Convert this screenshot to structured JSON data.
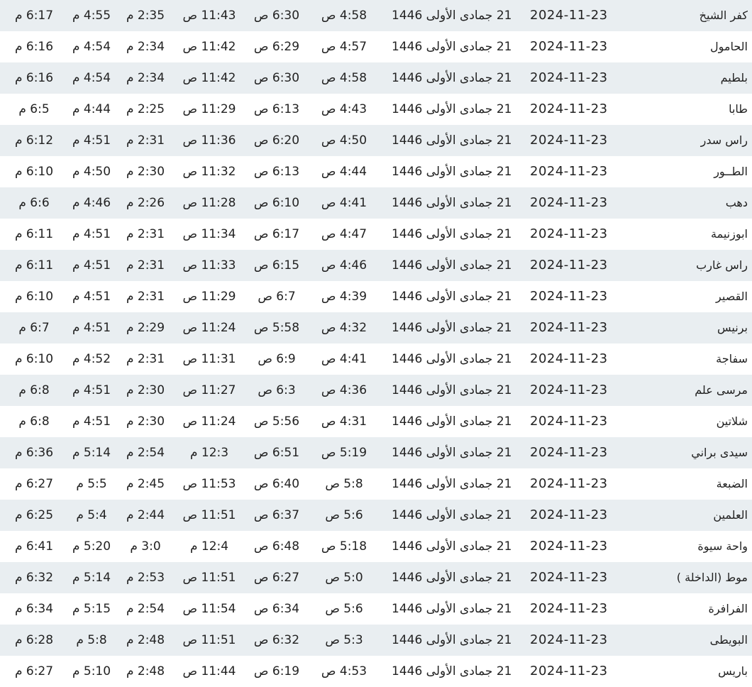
{
  "colors": {
    "row_alt_bg": "#e9eef1",
    "row_bg": "#ffffff",
    "text": "#222222"
  },
  "rows": [
    {
      "city": "كفر الشيخ",
      "gregorian": "2024-11-23",
      "hijri": "21 جمادى الأولى 1446",
      "fajr": "4:58 ص",
      "sunrise": "6:30 ص",
      "dhuhr": "11:43 ص",
      "asr": "2:35 م",
      "maghrib": "4:55 م",
      "isha": "6:17 م"
    },
    {
      "city": "الحامول",
      "gregorian": "2024-11-23",
      "hijri": "21 جمادى الأولى 1446",
      "fajr": "4:57 ص",
      "sunrise": "6:29 ص",
      "dhuhr": "11:42 ص",
      "asr": "2:34 م",
      "maghrib": "4:54 م",
      "isha": "6:16 م"
    },
    {
      "city": "بلطيم",
      "gregorian": "2024-11-23",
      "hijri": "21 جمادى الأولى 1446",
      "fajr": "4:58 ص",
      "sunrise": "6:30 ص",
      "dhuhr": "11:42 ص",
      "asr": "2:34 م",
      "maghrib": "4:54 م",
      "isha": "6:16 م"
    },
    {
      "city": "طابا",
      "gregorian": "2024-11-23",
      "hijri": "21 جمادى الأولى 1446",
      "fajr": "4:43 ص",
      "sunrise": "6:13 ص",
      "dhuhr": "11:29 ص",
      "asr": "2:25 م",
      "maghrib": "4:44 م",
      "isha": "6:5 م"
    },
    {
      "city": "راس سدر",
      "gregorian": "2024-11-23",
      "hijri": "21 جمادى الأولى 1446",
      "fajr": "4:50 ص",
      "sunrise": "6:20 ص",
      "dhuhr": "11:36 ص",
      "asr": "2:31 م",
      "maghrib": "4:51 م",
      "isha": "6:12 م"
    },
    {
      "city": "الطــور",
      "gregorian": "2024-11-23",
      "hijri": "21 جمادى الأولى 1446",
      "fajr": "4:44 ص",
      "sunrise": "6:13 ص",
      "dhuhr": "11:32 ص",
      "asr": "2:30 م",
      "maghrib": "4:50 م",
      "isha": "6:10 م"
    },
    {
      "city": "دهب",
      "gregorian": "2024-11-23",
      "hijri": "21 جمادى الأولى 1446",
      "fajr": "4:41 ص",
      "sunrise": "6:10 ص",
      "dhuhr": "11:28 ص",
      "asr": "2:26 م",
      "maghrib": "4:46 م",
      "isha": "6:6 م"
    },
    {
      "city": "ابوزنيمة",
      "gregorian": "2024-11-23",
      "hijri": "21 جمادى الأولى 1446",
      "fajr": "4:47 ص",
      "sunrise": "6:17 ص",
      "dhuhr": "11:34 ص",
      "asr": "2:31 م",
      "maghrib": "4:51 م",
      "isha": "6:11 م"
    },
    {
      "city": "راس غارب",
      "gregorian": "2024-11-23",
      "hijri": "21 جمادى الأولى 1446",
      "fajr": "4:46 ص",
      "sunrise": "6:15 ص",
      "dhuhr": "11:33 ص",
      "asr": "2:31 م",
      "maghrib": "4:51 م",
      "isha": "6:11 م"
    },
    {
      "city": "القصير",
      "gregorian": "2024-11-23",
      "hijri": "21 جمادى الأولى 1446",
      "fajr": "4:39 ص",
      "sunrise": "6:7 ص",
      "dhuhr": "11:29 ص",
      "asr": "2:31 م",
      "maghrib": "4:51 م",
      "isha": "6:10 م"
    },
    {
      "city": "برنيس",
      "gregorian": "2024-11-23",
      "hijri": "21 جمادى الأولى 1446",
      "fajr": "4:32 ص",
      "sunrise": "5:58 ص",
      "dhuhr": "11:24 ص",
      "asr": "2:29 م",
      "maghrib": "4:51 م",
      "isha": "6:7 م"
    },
    {
      "city": "سفاجة",
      "gregorian": "2024-11-23",
      "hijri": "21 جمادى الأولى 1446",
      "fajr": "4:41 ص",
      "sunrise": "6:9 ص",
      "dhuhr": "11:31 ص",
      "asr": "2:31 م",
      "maghrib": "4:52 م",
      "isha": "6:10 م"
    },
    {
      "city": "مرسى علم",
      "gregorian": "2024-11-23",
      "hijri": "21 جمادى الأولى 1446",
      "fajr": "4:36 ص",
      "sunrise": "6:3 ص",
      "dhuhr": "11:27 ص",
      "asr": "2:30 م",
      "maghrib": "4:51 م",
      "isha": "6:8 م"
    },
    {
      "city": "شلاتين",
      "gregorian": "2024-11-23",
      "hijri": "21 جمادى الأولى 1446",
      "fajr": "4:31 ص",
      "sunrise": "5:56 ص",
      "dhuhr": "11:24 ص",
      "asr": "2:30 م",
      "maghrib": "4:51 م",
      "isha": "6:8 م"
    },
    {
      "city": "سيدى براني",
      "gregorian": "2024-11-23",
      "hijri": "21 جمادى الأولى 1446",
      "fajr": "5:19 ص",
      "sunrise": "6:51 ص",
      "dhuhr": "12:3 م",
      "asr": "2:54 م",
      "maghrib": "5:14 م",
      "isha": "6:36 م"
    },
    {
      "city": "الضبعة",
      "gregorian": "2024-11-23",
      "hijri": "21 جمادى الأولى 1446",
      "fajr": "5:8 ص",
      "sunrise": "6:40 ص",
      "dhuhr": "11:53 ص",
      "asr": "2:45 م",
      "maghrib": "5:5 م",
      "isha": "6:27 م"
    },
    {
      "city": "العلمين",
      "gregorian": "2024-11-23",
      "hijri": "21 جمادى الأولى 1446",
      "fajr": "5:6 ص",
      "sunrise": "6:37 ص",
      "dhuhr": "11:51 ص",
      "asr": "2:44 م",
      "maghrib": "5:4 م",
      "isha": "6:25 م"
    },
    {
      "city": "واحة سيوة",
      "gregorian": "2024-11-23",
      "hijri": "21 جمادى الأولى 1446",
      "fajr": "5:18 ص",
      "sunrise": "6:48 ص",
      "dhuhr": "12:4 م",
      "asr": "3:0 م",
      "maghrib": "5:20 م",
      "isha": "6:41 م"
    },
    {
      "city": "موط (الداخلة )",
      "gregorian": "2024-11-23",
      "hijri": "21 جمادى الأولى 1446",
      "fajr": "5:0 ص",
      "sunrise": "6:27 ص",
      "dhuhr": "11:51 ص",
      "asr": "2:53 م",
      "maghrib": "5:14 م",
      "isha": "6:32 م"
    },
    {
      "city": "الفرافرة",
      "gregorian": "2024-11-23",
      "hijri": "21 جمادى الأولى 1446",
      "fajr": "5:6 ص",
      "sunrise": "6:34 ص",
      "dhuhr": "11:54 ص",
      "asr": "2:54 م",
      "maghrib": "5:15 م",
      "isha": "6:34 م"
    },
    {
      "city": "البويطى",
      "gregorian": "2024-11-23",
      "hijri": "21 جمادى الأولى 1446",
      "fajr": "5:3 ص",
      "sunrise": "6:32 ص",
      "dhuhr": "11:51 ص",
      "asr": "2:48 م",
      "maghrib": "5:8 م",
      "isha": "6:28 م"
    },
    {
      "city": "باريس",
      "gregorian": "2024-11-23",
      "hijri": "21 جمادى الأولى 1446",
      "fajr": "4:53 ص",
      "sunrise": "6:19 ص",
      "dhuhr": "11:44 ص",
      "asr": "2:48 م",
      "maghrib": "5:10 م",
      "isha": "6:27 م"
    }
  ]
}
